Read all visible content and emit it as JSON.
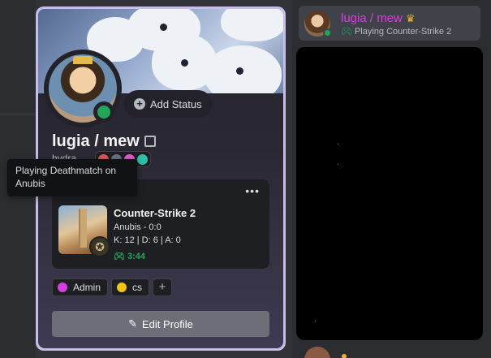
{
  "member_list": {
    "name": "lugia / mew",
    "crown_icon": "crown-icon",
    "activity": "Playing Counter-Strike 2",
    "activity_icon": "gamepad-icon",
    "status_color": "#23a55a",
    "name_color": "#d63ee0"
  },
  "profile": {
    "display_name": "lugia / mew",
    "username": "hydra",
    "add_status_label": "Add Status",
    "border_color": "#c6bde8",
    "status_color": "#23a55a",
    "badges": [
      {
        "icon": "badge-red-icon",
        "color": "#e0555a"
      },
      {
        "icon": "badge-dark-icon",
        "color": "#6b6f86"
      },
      {
        "icon": "badge-pink-icon",
        "color": "#e45bd0"
      },
      {
        "icon": "badge-teal-icon",
        "color": "#2fbfa6"
      }
    ]
  },
  "activity": {
    "more_label": "•••",
    "game_title": "Counter-Strike 2",
    "detail_map": "Anubis - 0:0",
    "detail_stats": "K: 12 | D: 6 | A: 0",
    "elapsed": "3:44"
  },
  "roles": [
    {
      "label": "Admin",
      "color": "#d63ee0"
    },
    {
      "label": "cs",
      "color": "#f0c419"
    }
  ],
  "edit_profile_label": "Edit Profile",
  "tooltip": "Playing Deathmatch on Anubis"
}
